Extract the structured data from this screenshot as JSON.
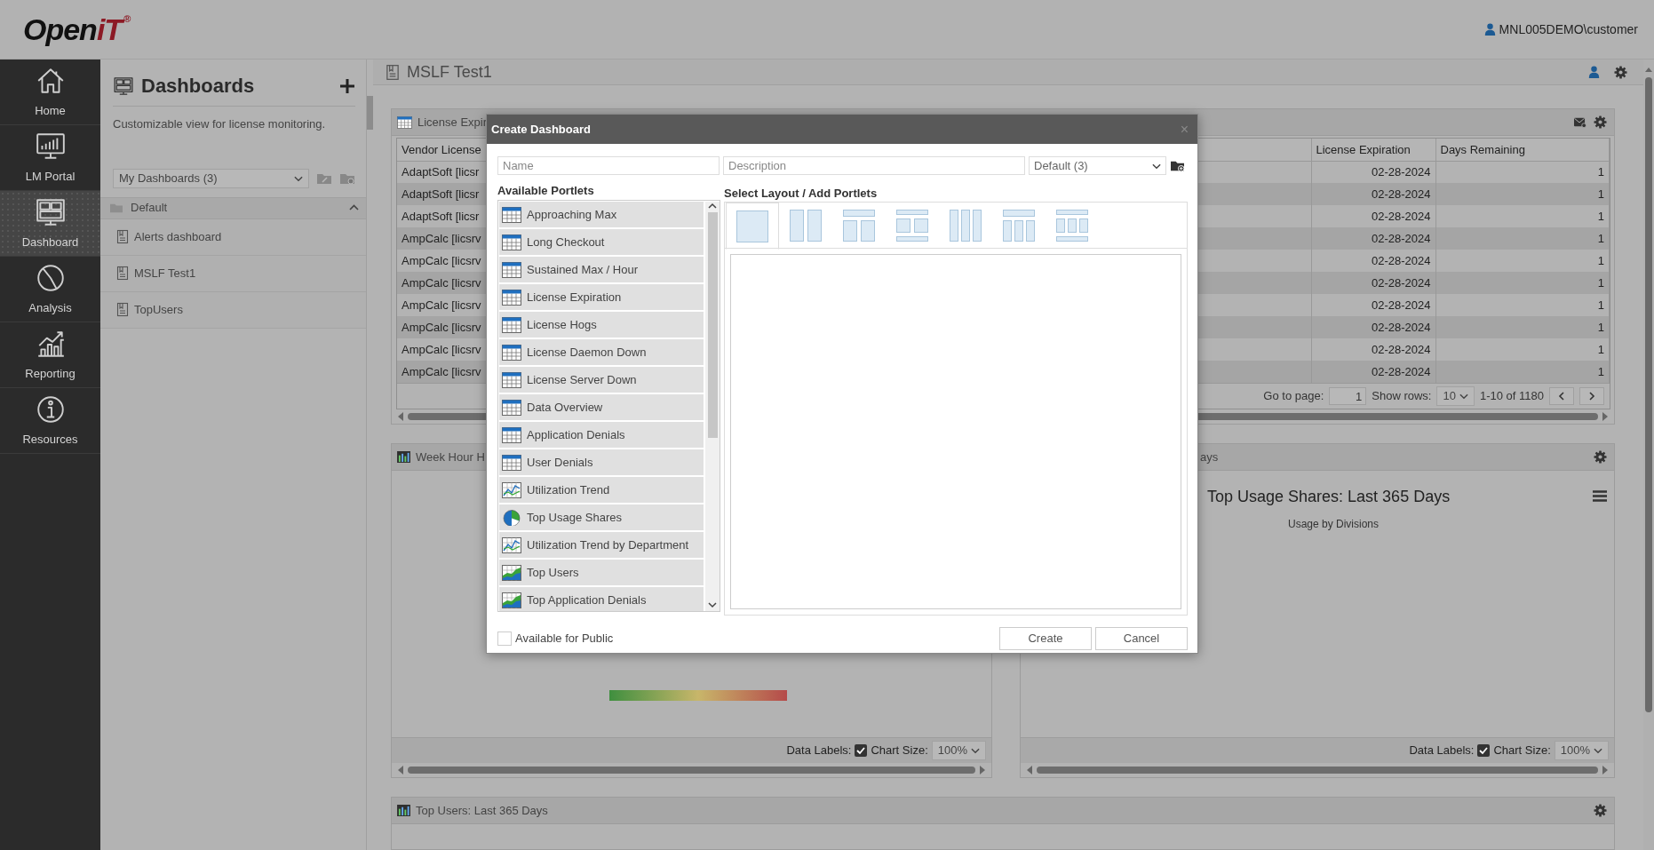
{
  "header": {
    "logo": {
      "word": "Open",
      "accent": "iT",
      "mark": "®"
    },
    "user": "MNL005DEMO\\customer"
  },
  "nav": [
    {
      "label": "Home",
      "kind": "home",
      "selected": false
    },
    {
      "label": "LM Portal",
      "kind": "portal",
      "selected": false
    },
    {
      "label": "Dashboard",
      "kind": "dashboard",
      "selected": true
    },
    {
      "label": "Analysis",
      "kind": "analysis",
      "selected": false
    },
    {
      "label": "Reporting",
      "kind": "reporting",
      "selected": false
    },
    {
      "label": "Resources",
      "kind": "resources",
      "selected": false
    }
  ],
  "dashboards_panel": {
    "title": "Dashboards",
    "description": "Customizable view for license monitoring.",
    "filter": "My Dashboards (3)",
    "group": {
      "label": "Default",
      "expanded": true,
      "items": [
        {
          "label": "Alerts dashboard"
        },
        {
          "label": "MSLF Test1"
        },
        {
          "label": "TopUsers"
        }
      ]
    }
  },
  "page": {
    "title": "MSLF Test1"
  },
  "portlet_rows": [
    [
      {
        "kind": "table",
        "title": "License Expir",
        "columns": [
          "Vendor License",
          "License Expiration",
          "Days Remaining"
        ],
        "rows": [
          [
            "AdaptSoft [licsr",
            "02-28-2024",
            "1"
          ],
          [
            "AdaptSoft [licsr",
            "02-28-2024",
            "1"
          ],
          [
            "AdaptSoft [licsr",
            "02-28-2024",
            "1"
          ],
          [
            "AmpCalc [licsrv",
            "02-28-2024",
            "1"
          ],
          [
            "AmpCalc [licsrv",
            "02-28-2024",
            "1"
          ],
          [
            "AmpCalc [licsrv",
            "02-28-2024",
            "1"
          ],
          [
            "AmpCalc [licsrv",
            "02-28-2024",
            "1"
          ],
          [
            "AmpCalc [licsrv",
            "02-28-2024",
            "1"
          ],
          [
            "AmpCalc [licsrv",
            "02-28-2024",
            "1"
          ],
          [
            "AmpCalc [licsrv",
            "02-28-2024",
            "1"
          ]
        ],
        "pager": {
          "page_label": "Go to page:",
          "page": "1",
          "rows_label": "Show rows:",
          "rows": "10",
          "range": "1-10 of 1180"
        }
      }
    ],
    [
      {
        "kind": "heatmap",
        "title": "Week Hour H",
        "footer": {
          "data_labels_label": "Data Labels:",
          "data_labels": true,
          "size_label": "Chart Size:",
          "size": "100%"
        }
      },
      {
        "kind": "pie",
        "title": "ays",
        "chart_title": "Top Usage Shares: Last 365 Days",
        "chart_subtitle": "Usage by Divisions",
        "footer": {
          "data_labels_label": "Data Labels:",
          "data_labels": true,
          "size_label": "Chart Size:",
          "size": "100%"
        }
      }
    ],
    [
      {
        "kind": "bars",
        "title": "Top Users: Last 365 Days"
      }
    ]
  ],
  "modal": {
    "title": "Create Dashboard",
    "close": "×",
    "name_placeholder": "Name",
    "description_placeholder": "Description",
    "folder": "Default (3)",
    "portlets_label": "Available Portlets",
    "portlets": [
      {
        "label": "Approaching Max",
        "kind": "table"
      },
      {
        "label": "Long Checkout",
        "kind": "table"
      },
      {
        "label": "Sustained Max / Hour",
        "kind": "table"
      },
      {
        "label": "License Expiration",
        "kind": "table"
      },
      {
        "label": "License Hogs",
        "kind": "table"
      },
      {
        "label": "License Daemon Down",
        "kind": "table"
      },
      {
        "label": "License Server Down",
        "kind": "table"
      },
      {
        "label": "Data Overview",
        "kind": "table"
      },
      {
        "label": "Application Denials",
        "kind": "table"
      },
      {
        "label": "User Denials",
        "kind": "table"
      },
      {
        "label": "Utilization Trend",
        "kind": "trend"
      },
      {
        "label": "Top Usage Shares",
        "kind": "pie"
      },
      {
        "label": "Utilization Trend by Department",
        "kind": "trend"
      },
      {
        "label": "Top Users",
        "kind": "area"
      },
      {
        "label": "Top Application Denials",
        "kind": "area"
      }
    ],
    "layout_label": "Select Layout / Add Portlets",
    "layouts": [
      {
        "kind": "single",
        "selected": true
      },
      {
        "kind": "columns2",
        "selected": false
      },
      {
        "kind": "header2",
        "selected": false
      },
      {
        "kind": "framed2",
        "selected": false
      },
      {
        "kind": "columns3",
        "selected": false
      },
      {
        "kind": "header3",
        "selected": false
      },
      {
        "kind": "framed3",
        "selected": false
      }
    ],
    "public": {
      "label": "Available for Public",
      "checked": false
    },
    "buttons": [
      "Create",
      "Cancel"
    ]
  }
}
